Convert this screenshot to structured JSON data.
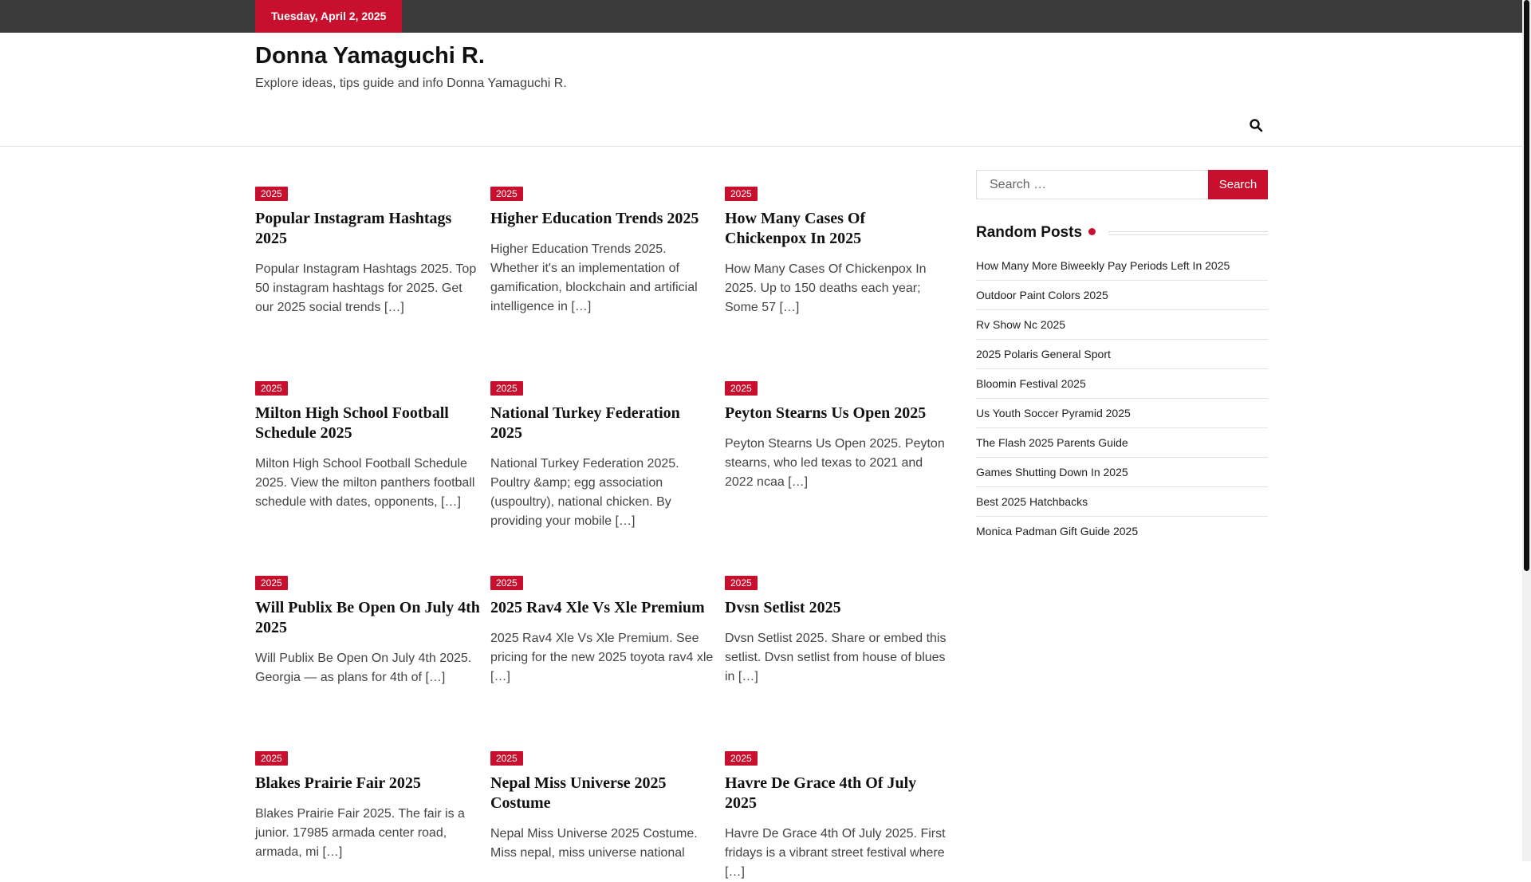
{
  "topbar": {
    "date": "Tuesday, April 2, 2025"
  },
  "site": {
    "title": "Donna Yamaguchi R.",
    "description": "Explore ideas, tips guide and info Donna Yamaguchi R."
  },
  "posts": [
    {
      "category": "2025",
      "title": "Popular Instagram Hashtags 2025",
      "excerpt": "Popular Instagram Hashtags 2025. Top 50 instagram hashtags for 2025. Get our 2025 social trends […]"
    },
    {
      "category": "2025",
      "title": "Higher Education Trends 2025",
      "excerpt": "Higher Education Trends 2025. Whether it's an implementation of gamification, blockchain and artificial intelligence in […]"
    },
    {
      "category": "2025",
      "title": "How Many Cases Of Chickenpox In 2025",
      "excerpt": "How Many Cases Of Chickenpox In 2025. Up to 150 deaths each year; Some 57 […]"
    },
    {
      "category": "2025",
      "title": "Milton High School Football Schedule 2025",
      "excerpt": "Milton High School Football Schedule 2025. View the milton panthers football schedule with dates, opponents, […]"
    },
    {
      "category": "2025",
      "title": "National Turkey Federation 2025",
      "excerpt": "National Turkey Federation 2025. Poultry &amp; egg association (uspoultry), national chicken. By providing your mobile […]"
    },
    {
      "category": "2025",
      "title": "Peyton Stearns Us Open 2025",
      "excerpt": "Peyton Stearns Us Open 2025. Peyton stearns, who led texas to 2021 and 2022 ncaa […]"
    },
    {
      "category": "2025",
      "title": "Will Publix Be Open On July 4th 2025",
      "excerpt": "Will Publix Be Open On July 4th 2025. Georgia — as plans for 4th of […]"
    },
    {
      "category": "2025",
      "title": "2025 Rav4 Xle Vs Xle Premium",
      "excerpt": "2025 Rav4 Xle Vs Xle Premium. See pricing for the new 2025 toyota rav4 xle […]"
    },
    {
      "category": "2025",
      "title": "Dvsn Setlist 2025",
      "excerpt": "Dvsn Setlist 2025. Share or embed this setlist. Dvsn setlist from house of blues in […]"
    },
    {
      "category": "2025",
      "title": "Blakes Prairie Fair 2025",
      "excerpt": "Blakes Prairie Fair 2025. The fair is a junior. 17985 armada center road, armada, mi […]"
    },
    {
      "category": "2025",
      "title": "Nepal Miss Universe 2025 Costume",
      "excerpt": "Nepal Miss Universe 2025 Costume. Miss nepal, miss universe national"
    },
    {
      "category": "2025",
      "title": "Havre De Grace 4th Of July 2025",
      "excerpt": "Havre De Grace 4th Of July 2025. First fridays is a vibrant street festival where […]"
    }
  ],
  "sidebar": {
    "search": {
      "placeholder": "Search …",
      "button": "Search"
    },
    "random_posts": {
      "title": "Random Posts",
      "items": [
        "How Many More Biweekly Pay Periods Left In 2025",
        "Outdoor Paint Colors 2025",
        "Rv Show Nc 2025",
        "2025 Polaris General Sport",
        "Bloomin Festival 2025",
        "Us Youth Soccer Pyramid 2025",
        "The Flash 2025 Parents Guide",
        "Games Shutting Down In 2025",
        "Best 2025 Hatchbacks",
        "Monica Padman Gift Guide 2025"
      ]
    }
  },
  "colors": {
    "accent": "#c8102e",
    "topbar": "#3b3b3b"
  },
  "icons": {
    "nav_search": "search-icon"
  }
}
